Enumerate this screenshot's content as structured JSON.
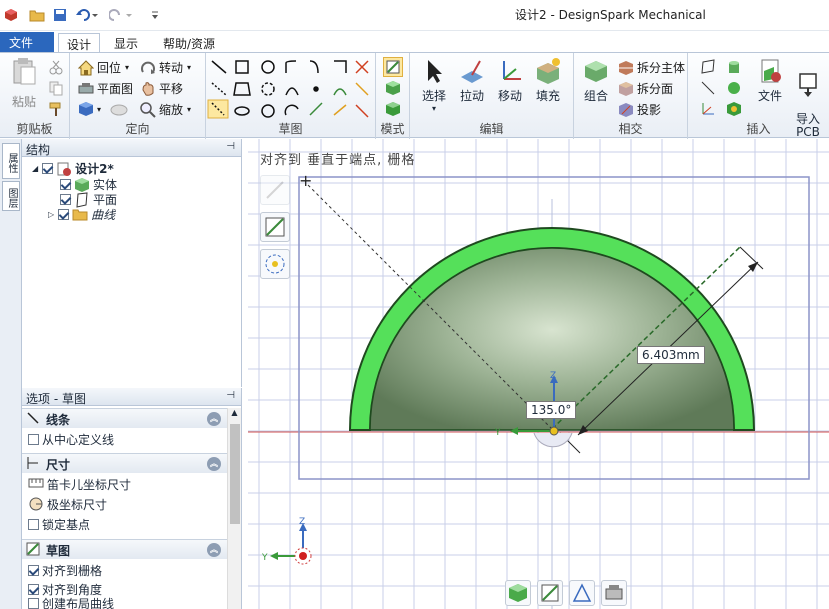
{
  "window": {
    "title": "设计2 - DesignSpark Mechanical"
  },
  "tabs": [
    {
      "label": "文件(F)"
    },
    {
      "label": "设计"
    },
    {
      "label": "显示"
    },
    {
      "label": "帮助/资源"
    }
  ],
  "ribbon": {
    "clipboard": {
      "label": "剪贴板",
      "paste": "粘贴"
    },
    "orient": {
      "label": "定向",
      "home": "回位",
      "plan": "平面图",
      "spin": "转动",
      "pan": "平移",
      "zoom": "缩放"
    },
    "sketch": {
      "label": "草图"
    },
    "mode": {
      "label": "模式"
    },
    "edit": {
      "label": "编辑",
      "select": "选择",
      "pull": "拉动",
      "move": "移动",
      "fill": "填充"
    },
    "intersect": {
      "label": "相交",
      "combine": "组合",
      "split_body": "拆分主体",
      "split_face": "拆分面",
      "project": "投影"
    },
    "insert": {
      "label": "插入",
      "file": "文件",
      "import_pcb": "导入\nPCB"
    }
  },
  "side_tabs": [
    "属性",
    "图层"
  ],
  "structure": {
    "title": "结构",
    "items": [
      {
        "label": "设计2*"
      },
      {
        "label": "实体"
      },
      {
        "label": "平面"
      },
      {
        "label": "曲线"
      }
    ]
  },
  "options": {
    "title": "选项 - 草图",
    "sections": [
      {
        "title": "线条",
        "items": [
          {
            "label": "从中心定义线",
            "checked": false
          }
        ]
      },
      {
        "title": "尺寸",
        "items": [
          {
            "label": "笛卡儿坐标尺寸"
          },
          {
            "label": "极坐标尺寸"
          },
          {
            "label": "锁定基点",
            "checked": false
          }
        ]
      },
      {
        "title": "草图",
        "items": [
          {
            "label": "对齐到栅格",
            "checked": true
          },
          {
            "label": "对齐到角度",
            "checked": true
          },
          {
            "label": "创建布局曲线",
            "checked": false
          }
        ]
      }
    ]
  },
  "canvas": {
    "hint": "对齐到 垂直于端点, 栅格",
    "dim_length": "6.403mm",
    "dim_angle": "135.0°",
    "axis_z": "Z",
    "axis_y": "Y",
    "colors": {
      "ring": "#55e05a",
      "body": "#7fa07a",
      "grid": "#c9cfe8",
      "redaxis": "#d05050"
    }
  }
}
